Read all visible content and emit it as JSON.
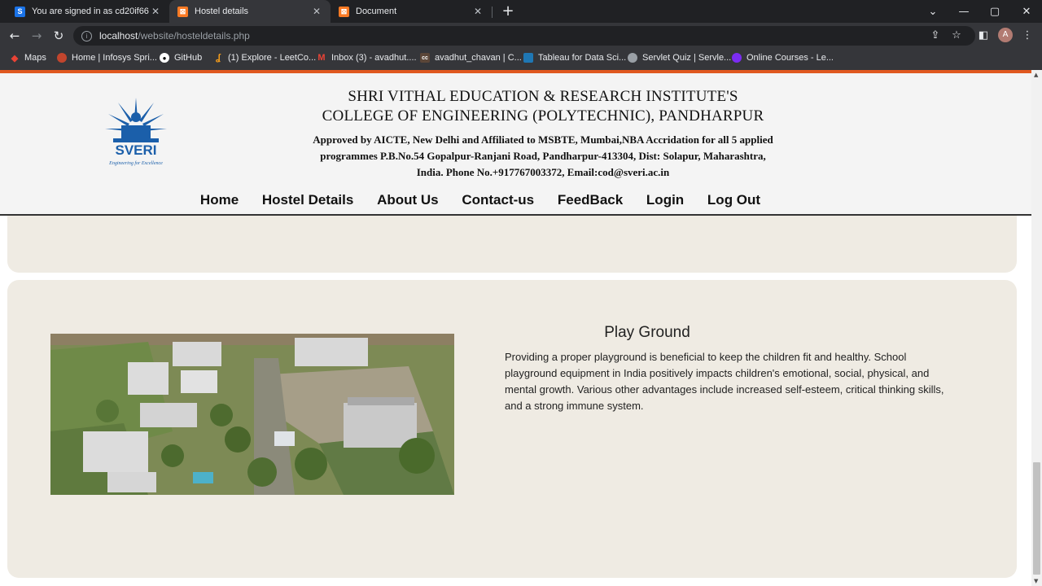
{
  "browser": {
    "tabs": [
      {
        "title": "You are signed in as cd20if66",
        "icon": "s-icon",
        "color": "#1a73e8",
        "glyph": "S"
      },
      {
        "title": "Hostel details",
        "icon": "xampp-icon",
        "color": "#fb7a24",
        "glyph": "⊠"
      },
      {
        "title": "Document",
        "icon": "xampp-icon",
        "color": "#fb7a24",
        "glyph": "⊠"
      }
    ],
    "url_host": "localhost",
    "url_path": "/website/hosteldetails.php",
    "avatar_letter": "A",
    "bookmarks": [
      {
        "label": "Maps",
        "icon": "maps-icon",
        "color": "#34a853"
      },
      {
        "label": "Home | Infosys Spri...",
        "icon": "infosys-icon",
        "color": "#c2452d"
      },
      {
        "label": "GitHub",
        "icon": "github-icon",
        "color": "#ffffff"
      },
      {
        "label": "(1) Explore - LeetCo...",
        "icon": "leetcode-icon",
        "color": "#f89f1b"
      },
      {
        "label": "Inbox (3) - avadhut....",
        "icon": "gmail-icon",
        "color": "#ea4335"
      },
      {
        "label": "avadhut_chavan | C...",
        "icon": "codechef-icon",
        "color": "#5b4638"
      },
      {
        "label": "Tableau for Data Sci...",
        "icon": "tableau-icon",
        "color": "#1f77b4"
      },
      {
        "label": "Servlet Quiz | Servle...",
        "icon": "globe-icon",
        "color": "#9aa0a6"
      },
      {
        "label": "Online Courses - Le...",
        "icon": "course-icon",
        "color": "#7b2cf2"
      }
    ]
  },
  "header": {
    "logo_text": "SVERI",
    "logo_tagline": "Engineering for Excellence",
    "institute_line1": "SHRI VITHAL EDUCATION & RESEARCH INSTITUTE'S",
    "institute_line2": "COLLEGE OF ENGINEERING (POLYTECHNIC), PANDHARPUR",
    "approved_line1": "Approved by AICTE, New Delhi and Affiliated to MSBTE, Mumbai,NBA Accridation for all 5 applied",
    "approved_line2": "programmes P.B.No.54 Gopalpur-Ranjani Road, Pandharpur-413304, Dist: Solapur, Maharashtra,",
    "approved_line3": "India. Phone No.+917767003372, Email:cod@sveri.ac.in"
  },
  "nav": {
    "items": [
      "Home",
      "Hostel Details",
      "About Us",
      "Contact-us",
      "FeedBack",
      "Login",
      "Log Out"
    ]
  },
  "section": {
    "title": "Play Ground",
    "description": "Providing a proper playground is beneficial to keep the children fit and healthy. School playground equipment in India positively impacts children's emotional, social, physical, and mental growth. Various other advantages include increased self-esteem, critical thinking skills, and a strong immune system."
  },
  "colors": {
    "accent": "#e0581f",
    "card_bg": "#efebe3",
    "header_bg": "#f4f4f4"
  }
}
